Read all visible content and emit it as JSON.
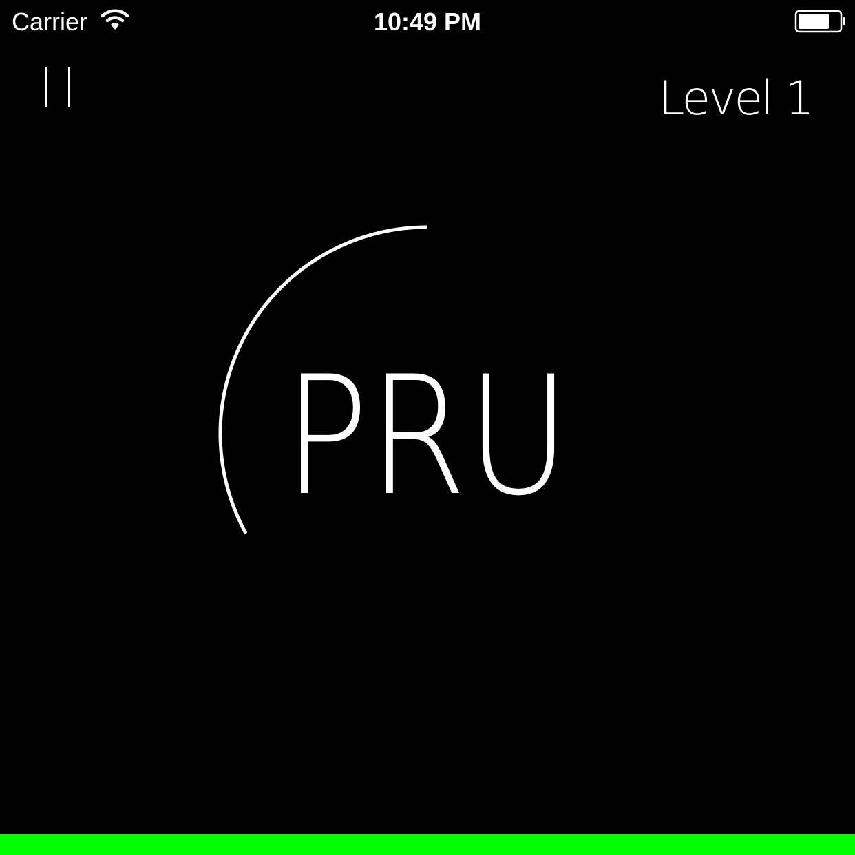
{
  "status_bar": {
    "carrier": "Carrier",
    "time": "10:49 PM",
    "wifi_icon": "wifi-icon",
    "battery_icon": "battery-icon"
  },
  "controls": {
    "pause_icon": "pause-icon",
    "level_label": "Level 1"
  },
  "game": {
    "word": "PRU",
    "arc_progress_fraction": 0.33,
    "arc_color": "#ffffff"
  },
  "timer_bar": {
    "color": "#00ff00",
    "fill_fraction": 1.0
  },
  "colors": {
    "background": "#000000",
    "foreground": "#ffffff",
    "accent": "#00ff00"
  }
}
